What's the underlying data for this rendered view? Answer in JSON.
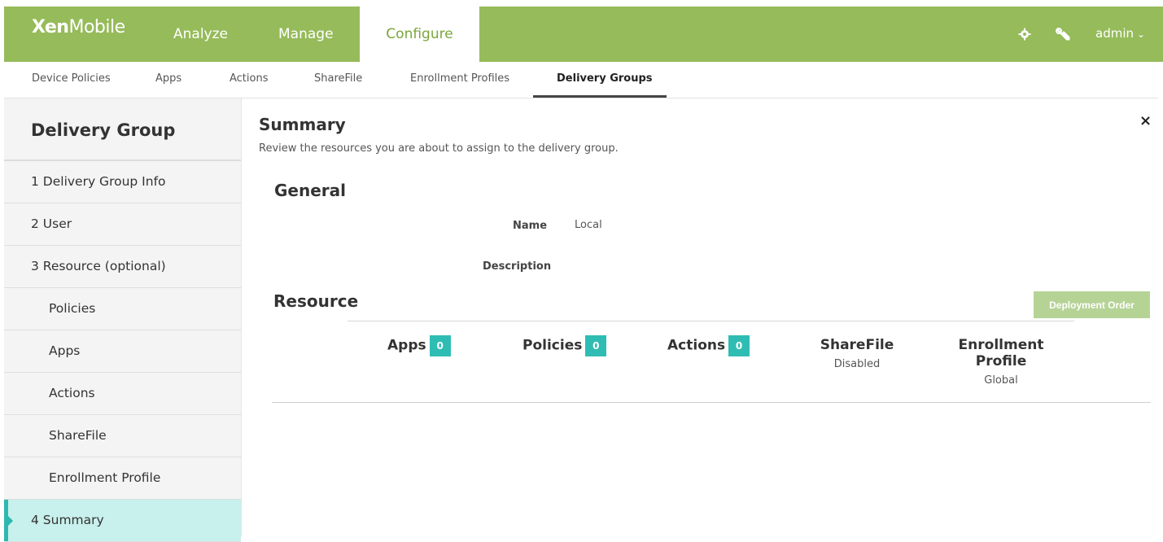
{
  "header": {
    "logo_bold": "Xen",
    "logo_light": "Mobile",
    "nav": [
      "Analyze",
      "Manage",
      "Configure"
    ],
    "user": "admin",
    "icons": [
      "gear-icon",
      "wrench-icon",
      "chevron-down-icon"
    ],
    "brand_color": "#96bb5a"
  },
  "subnav": {
    "items": [
      "Device Policies",
      "Apps",
      "Actions",
      "ShareFile",
      "Enrollment Profiles",
      "Delivery Groups"
    ],
    "active": "Delivery Groups"
  },
  "sidebar": {
    "title": "Delivery Group",
    "items": [
      "1  Delivery Group Info",
      "2  User",
      "3  Resource (optional)",
      "Policies",
      "Apps",
      "Actions",
      "ShareFile",
      "Enrollment Profile",
      "4  Summary"
    ],
    "active": "4  Summary",
    "accent_color": "#2eb8b0"
  },
  "main": {
    "title": "Summary",
    "subtitle": "Review the resources you are about to assign to the delivery group.",
    "general_heading": "General",
    "name_label": "Name",
    "name_value": "Local",
    "description_label": "Description",
    "resource_heading": "Resource",
    "deployment_order_label": "Deployment Order",
    "close_label": "×",
    "columns": [
      {
        "name": "Apps",
        "count": "0"
      },
      {
        "name": "Policies",
        "count": "0"
      },
      {
        "name": "Actions",
        "count": "0"
      },
      {
        "name": "ShareFile",
        "status": "Disabled"
      },
      {
        "name_line1": "Enrollment",
        "name_line2": "Profile",
        "status": "Global"
      }
    ]
  }
}
